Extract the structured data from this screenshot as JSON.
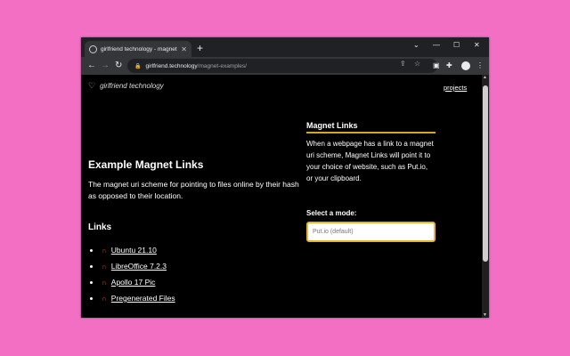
{
  "browser": {
    "tab_title": "girlfriend technology - magnet",
    "url_host": "girlfriend.technology",
    "url_path": "/magnet-examples/"
  },
  "site": {
    "logo_text": "girlfriend technology",
    "projects_link": "projects"
  },
  "main": {
    "heading": "Example Magnet Links",
    "intro": "The magnet uri scheme for pointing to files online by their hash as opposed to their location.",
    "links_heading": "Links",
    "links": [
      {
        "label": "Ubuntu 21.10"
      },
      {
        "label": "LibreOffice 7.2.3"
      },
      {
        "label": "Apollo 17 Pic"
      },
      {
        "label": "Pregenerated Files"
      }
    ]
  },
  "sidebar": {
    "title": "Magnet Links",
    "body": "When a webpage has a link to a magnet uri scheme, Magnet Links will point it to your choice of website, such as Put.io, or your clipboard.",
    "mode_label": "Select a mode:",
    "mode_value": "Put.io (default)"
  },
  "colors": {
    "background": "#f26fc4",
    "accent": "#d6a81c",
    "magnet_icon": "#e8413c"
  }
}
